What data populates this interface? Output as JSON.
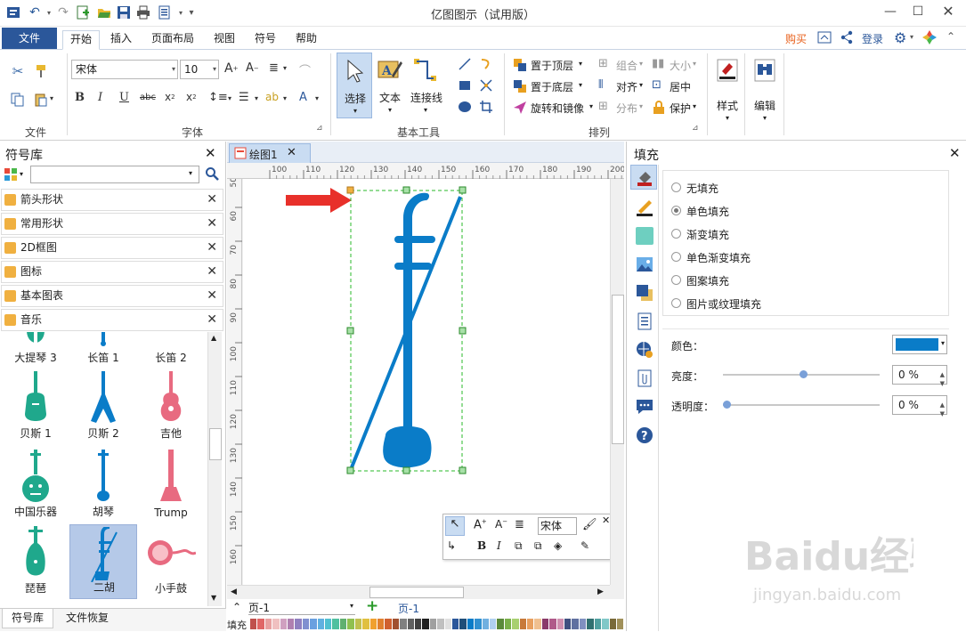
{
  "title_bar": {
    "app_title": "亿图图示（试用版）"
  },
  "menu": {
    "file": "文件",
    "tabs": [
      "开始",
      "插入",
      "页面布局",
      "视图",
      "符号",
      "帮助"
    ],
    "buy": "购买",
    "login": "登录"
  },
  "ribbon": {
    "groups": {
      "file": "文件",
      "font": "字体",
      "basic_tools": "基本工具",
      "arrange": "排列"
    },
    "font_name": "宋体",
    "font_size": "10",
    "tools": {
      "select": "选择",
      "text": "文本",
      "connector": "连接线"
    },
    "arrange": {
      "bring_front": "置于顶层",
      "send_back": "置于底层",
      "rotate_flip": "旋转和镜像",
      "group": "组合",
      "align": "对齐",
      "distribute": "分布",
      "size": "大小",
      "center": "居中",
      "protect": "保护"
    },
    "style": "样式",
    "edit": "编辑"
  },
  "symbol_library": {
    "title": "符号库",
    "search_placeholder": "",
    "categories": [
      "箭头形状",
      "常用形状",
      "2D框图",
      "图标",
      "基本图表",
      "音乐"
    ],
    "symbols": [
      {
        "label": "大提琴 3"
      },
      {
        "label": "长笛 1"
      },
      {
        "label": "长笛 2"
      },
      {
        "label": "贝斯 1"
      },
      {
        "label": "贝斯 2"
      },
      {
        "label": "吉他"
      },
      {
        "label": "中国乐器"
      },
      {
        "label": "胡琴"
      },
      {
        "label": "Trump"
      },
      {
        "label": "琵琶"
      },
      {
        "label": "二胡"
      },
      {
        "label": "小手鼓"
      }
    ],
    "bottom_tabs": [
      "符号库",
      "文件恢复"
    ]
  },
  "document": {
    "tab": "绘图1",
    "hruler": [
      "100",
      "110",
      "120",
      "130",
      "140",
      "150",
      "160",
      "170",
      "180",
      "190",
      "200"
    ],
    "vruler": [
      "50",
      "60",
      "70",
      "80",
      "90",
      "100",
      "110",
      "120",
      "130",
      "140",
      "150",
      "160"
    ],
    "page_select": "页-1",
    "page_tab": "页-1",
    "fill_label": "填充",
    "mini_toolbar_font": "宋体"
  },
  "fill_panel": {
    "title": "填充",
    "options": [
      "无填充",
      "单色填充",
      "渐变填充",
      "单色渐变填充",
      "图案填充",
      "图片或纹理填充"
    ],
    "selected_option": "单色填充",
    "color_label": "颜色：",
    "brightness_label": "亮度：",
    "brightness_value": "0 %",
    "transparency_label": "透明度：",
    "transparency_value": "0 %",
    "color_value": "#0a7cc8"
  },
  "colors": {
    "accent": "#2b579a",
    "erhu_blue": "#0a7cc8",
    "buy_orange": "#e8601c"
  }
}
